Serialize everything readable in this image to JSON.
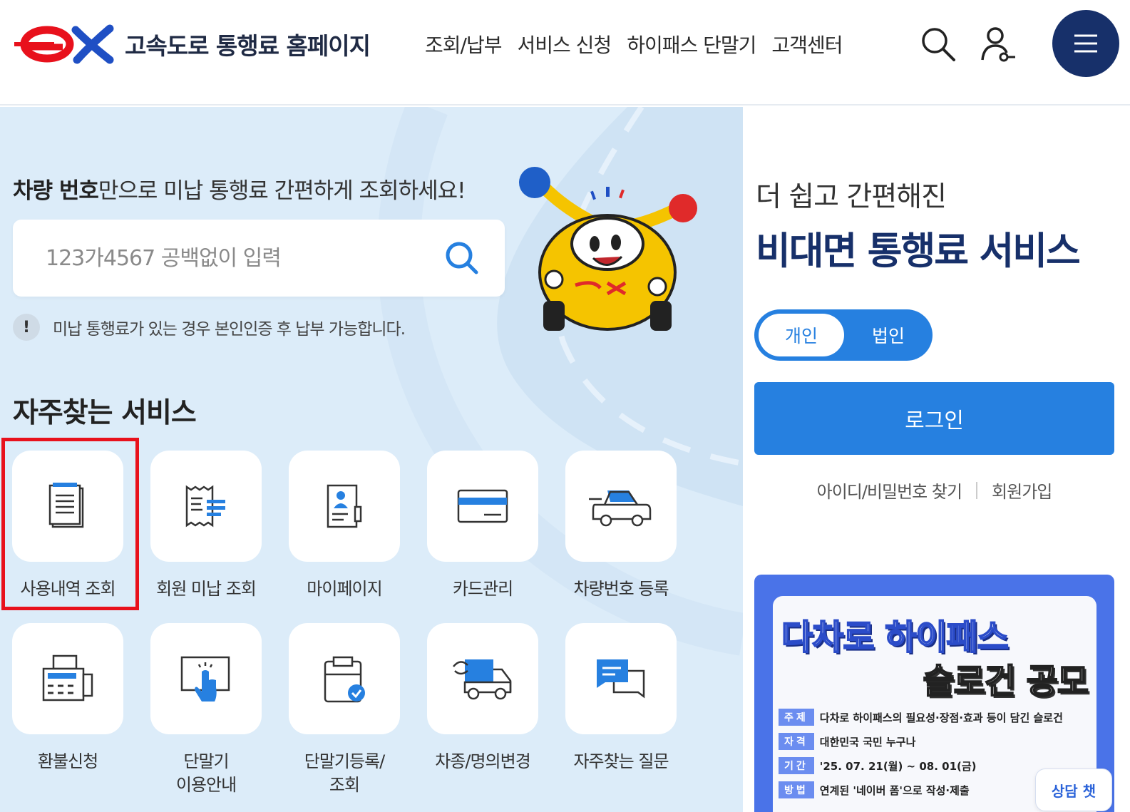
{
  "header": {
    "site_title": "고속도로 통행료 홈페이지",
    "nav": [
      "조회/납부",
      "서비스 신청",
      "하이패스 단말기",
      "고객센터"
    ],
    "icons": [
      "search-icon",
      "user-icon",
      "menu-icon"
    ],
    "brand_color": "#17306a"
  },
  "hero": {
    "headline_bold": "차량 번호",
    "headline_rest": "만으로 미납 통행료 간편하게 조회하세요!",
    "search_placeholder": "123가4567 공백없이 입력",
    "notice_mark": "!",
    "notice": "미납 통행료가 있는 경우 본인인증 후 납부 가능합니다."
  },
  "services": {
    "title": "자주찾는 서비스",
    "items": [
      {
        "label": "사용내역 조회",
        "icon": "document-list-icon"
      },
      {
        "label": "회원 미납 조회",
        "icon": "receipt-icon"
      },
      {
        "label": "마이페이지",
        "icon": "profile-card-icon"
      },
      {
        "label": "카드관리",
        "icon": "card-icon"
      },
      {
        "label": "차량번호 등록",
        "icon": "car-icon"
      },
      {
        "label": "환불신청",
        "icon": "fax-icon"
      },
      {
        "label": "단말기\n이용안내",
        "icon": "touch-screen-icon"
      },
      {
        "label": "단말기등록/\n조회",
        "icon": "clipboard-check-icon"
      },
      {
        "label": "차종/명의변경",
        "icon": "truck-exchange-icon"
      },
      {
        "label": "자주찾는 질문",
        "icon": "chat-icon"
      }
    ]
  },
  "side": {
    "subtitle": "더 쉽고 간편해진",
    "title": "비대면 통행료 서비스",
    "toggle_personal": "개인",
    "toggle_corporate": "법인",
    "login": "로그인",
    "find_id": "아이디/비밀번호 찾기",
    "signup": "회원가입"
  },
  "banner": {
    "line1": "다차로 하이패스",
    "line2": "슬로건 공모",
    "rows": [
      {
        "tag": "주제",
        "text": "다차로 하이패스의 필요성·장점·효과 등이 담긴 슬로건"
      },
      {
        "tag": "자격",
        "text": "대한민국 국민 누구나"
      },
      {
        "tag": "기간",
        "text": "'25. 07. 21(월) ~ 08. 01(금)"
      },
      {
        "tag": "방법",
        "text": "연계된 '네이버 폼'으로 작성·제출"
      }
    ],
    "chat": "상담 챗"
  }
}
